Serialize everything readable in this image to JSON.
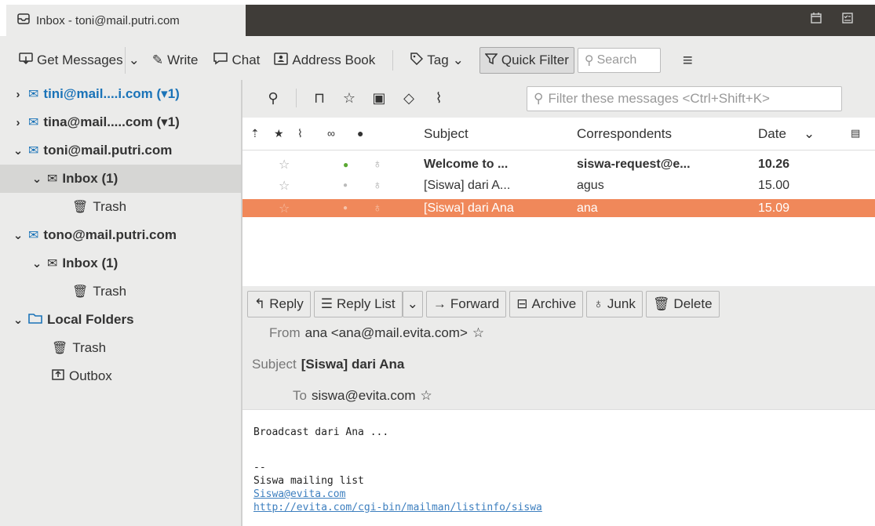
{
  "tab": {
    "title": "Inbox - toni@mail.putri.com"
  },
  "toolbar": {
    "get_messages": "Get Messages",
    "write": "Write",
    "chat": "Chat",
    "address_book": "Address Book",
    "tag": "Tag",
    "quick_filter": "Quick Filter",
    "search_placeholder": "Search"
  },
  "folders": [
    {
      "label": "tini@mail....i.com (▾1)",
      "chevron": "›",
      "icon": "✉"
    },
    {
      "label": "tina@mail.....com (▾1)",
      "chevron": "›",
      "icon": "✉"
    },
    {
      "label": "toni@mail.putri.com",
      "chevron": "⌄",
      "icon": "✉"
    },
    {
      "label": "Inbox (1)",
      "chevron": "⌄",
      "icon": "✉"
    },
    {
      "label": "Trash",
      "chevron": "",
      "icon": "✗"
    },
    {
      "label": "tono@mail.putri.com",
      "chevron": "⌄",
      "icon": "✉"
    },
    {
      "label": "Inbox (1)",
      "chevron": "⌄",
      "icon": "✉"
    },
    {
      "label": "Trash",
      "chevron": "",
      "icon": "✗"
    },
    {
      "label": "Local Folders",
      "chevron": "⌄",
      "icon": "▬"
    },
    {
      "label": "Trash",
      "chevron": "",
      "icon": "✗"
    },
    {
      "label": "Outbox",
      "chevron": "",
      "icon": "✉"
    }
  ],
  "thread_filter": {
    "placeholder": "Filter these messages <Ctrl+Shift+K>"
  },
  "columns": {
    "subject": "Subject",
    "correspondents": "Correspondents",
    "date": "Date"
  },
  "messages": [
    {
      "subject": "Welcome to ...",
      "correspondent": "siswa-request@e...",
      "date": "10.26"
    },
    {
      "subject": "[Siswa] dari A...",
      "correspondent": "agus",
      "date": "15.00"
    },
    {
      "subject": "[Siswa] dari Ana",
      "correspondent": "ana",
      "date": "15.09"
    }
  ],
  "message_actions": {
    "reply": "Reply",
    "reply_list": "Reply List",
    "forward": "Forward",
    "archive": "Archive",
    "junk": "Junk",
    "delete": "Delete"
  },
  "message_header": {
    "from_label": "From",
    "from_value": "ana <ana@mail.evita.com>",
    "subject_label": "Subject",
    "subject_value": "[Siswa] dari Ana",
    "to_label": "To",
    "to_value": "siswa@evita.com"
  },
  "message_body": {
    "line1": "Broadcast dari Ana ...",
    "sig_sep": "--",
    "list_name": "Siswa mailing list",
    "list_email": "Siswa@evita.com",
    "list_url": "http://evita.com/cgi-bin/mailman/listinfo/siswa"
  },
  "colors": {
    "selected_row": "#f0885a",
    "account_blue": "#1a73b8",
    "unread_dot": "#5aa832"
  }
}
